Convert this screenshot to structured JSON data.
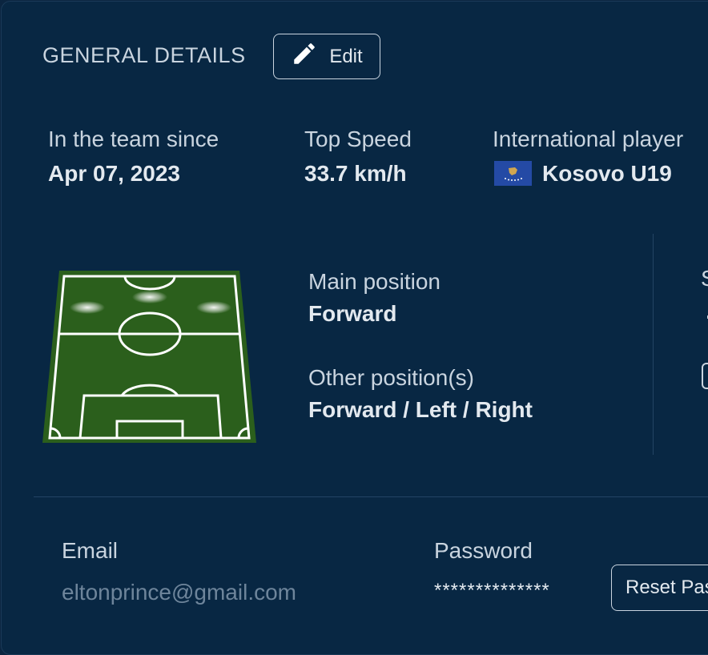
{
  "header": {
    "title": "GENERAL DETAILS",
    "edit_label": "Edit"
  },
  "details": {
    "team_since": {
      "label": "In the team since",
      "value": "Apr 07, 2023"
    },
    "top_speed": {
      "label": "Top Speed",
      "value": "33.7 km/h"
    },
    "international": {
      "label": "International player",
      "value": "Kosovo U19",
      "flag_icon": "kosovo-flag-icon"
    }
  },
  "positions": {
    "main_label": "Main position",
    "main_value": "Forward",
    "other_label": "Other position(s)",
    "other_value": "Forward / Left / Right"
  },
  "right_panel": {
    "label_partial": "S"
  },
  "account": {
    "email_label": "Email",
    "email_value": "eltonprince@gmail.com",
    "password_label": "Password",
    "password_value": "**************",
    "reset_label": "Reset Password"
  },
  "colors": {
    "background": "#082743",
    "pitch_green": "#2b5f1c",
    "flag_blue": "#244aa5",
    "flag_gold": "#d0a650"
  }
}
